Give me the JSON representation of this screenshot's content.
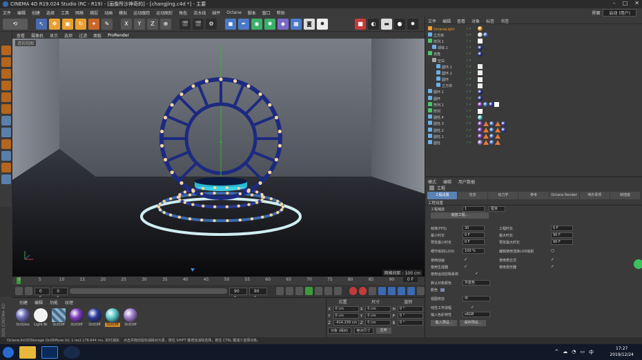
{
  "window": {
    "title": "CINEMA 4D R19.024 Studio (RC - R19) - [画像所沙神奇的] - [changjing.c4d *] - 主要",
    "controls": [
      "–",
      "□",
      "✕"
    ]
  },
  "menu": {
    "items": [
      "文件",
      "编辑",
      "创建",
      "选择",
      "工具",
      "网格",
      "捕捉",
      "动画",
      "模拟",
      "运动跟踪",
      "运动图形",
      "角色",
      "流水线",
      "插件",
      "Octane",
      "脚本",
      "窗口",
      "帮助"
    ],
    "layout_label": "界面",
    "layout_value": "启动 (用户)"
  },
  "toolbar": {
    "xyz": [
      "X",
      "Y",
      "Z"
    ]
  },
  "viewport": {
    "menu": [
      "查看",
      "摄像机",
      "显示",
      "选项",
      "过滤",
      "面板",
      "ProRender"
    ],
    "label": "透视视图",
    "grid_distance": "网格间距 : 100 cm"
  },
  "timeline": {
    "ticks": [
      "0",
      "5",
      "10",
      "15",
      "20",
      "25",
      "30",
      "35",
      "40",
      "45",
      "50",
      "55",
      "60",
      "65",
      "70",
      "75",
      "80",
      "85",
      "90"
    ],
    "current_frame": "0 F"
  },
  "playback": {
    "start": "0 F",
    "min": "0 F",
    "max": "90 F",
    "end": "90 F"
  },
  "materials": {
    "tabs": [
      "创建",
      "编辑",
      "功能",
      "纹理"
    ],
    "items": [
      {
        "label": "OctGlos",
        "color": "#6a6ab8"
      },
      {
        "label": "Light Br",
        "color": "#f2f2f2"
      },
      {
        "label": "OctDiff",
        "color": "#8ab0c8"
      },
      {
        "label": "OctDiff",
        "color": "#7a3ab8"
      },
      {
        "label": "OctDiff",
        "color": "#2a3a9a"
      },
      {
        "label": "OctDiff",
        "color": "#5ac8c8"
      },
      {
        "label": "OctDiff",
        "color": "#9a7ac8"
      }
    ],
    "selected_index": 5
  },
  "coordinates": {
    "headers": [
      "位置",
      "尺寸",
      "旋转"
    ],
    "rows": [
      {
        "axis": "X",
        "pos": "0 cm",
        "size": "0 cm",
        "rot_label": "H",
        "rot": "0 °"
      },
      {
        "axis": "Y",
        "pos": "0 cm",
        "size": "0 cm",
        "rot_label": "P",
        "rot": "0 °"
      },
      {
        "axis": "Z",
        "pos": "-414.239 cm",
        "size": "0 cm",
        "rot_label": "B",
        "rot": "0 °"
      }
    ],
    "mode": "对象 (相对)",
    "size_mode": "绝对尺寸",
    "apply": "应用"
  },
  "object_manager": {
    "menu": [
      "文件",
      "编辑",
      "查看",
      "对象",
      "标签",
      "书签"
    ],
    "objects": [
      {
        "name": "OctaneLight",
        "color": "#f0a030",
        "indent": 0,
        "selected": true
      },
      {
        "name": "立方体",
        "color": "#6ab0e8",
        "indent": 0
      },
      {
        "name": "阵列.1",
        "color": "#4ac86a",
        "indent": 0
      },
      {
        "name": "球体.1",
        "color": "#6ab0e8",
        "indent": 1
      },
      {
        "name": "克隆",
        "color": "#4ac86a",
        "indent": 0
      },
      {
        "name": "空白",
        "color": "#aaaaaa",
        "indent": 1
      },
      {
        "name": "圆环.1",
        "color": "#6ab0e8",
        "indent": 2
      },
      {
        "name": "圆环.2",
        "color": "#6ab0e8",
        "indent": 2
      },
      {
        "name": "圆环",
        "color": "#6ab0e8",
        "indent": 2
      },
      {
        "name": "立方体",
        "color": "#6ab0e8",
        "indent": 2
      },
      {
        "name": "圆环.1",
        "color": "#6ab0e8",
        "indent": 0
      },
      {
        "name": "圆环",
        "color": "#6ab0e8",
        "indent": 0
      },
      {
        "name": "阵列.1",
        "color": "#4ac86a",
        "indent": 0
      },
      {
        "name": "阵列",
        "color": "#4ac86a",
        "indent": 0
      },
      {
        "name": "圆柱.4",
        "color": "#6ab0e8",
        "indent": 0
      },
      {
        "name": "圆柱.3",
        "color": "#6ab0e8",
        "indent": 0
      },
      {
        "name": "圆柱.2",
        "color": "#6ab0e8",
        "indent": 0
      },
      {
        "name": "圆柱.1",
        "color": "#6ab0e8",
        "indent": 0
      },
      {
        "name": "圆柱",
        "color": "#6ab0e8",
        "indent": 0
      }
    ]
  },
  "attributes": {
    "menu": [
      "模式",
      "编辑",
      "用户数据"
    ],
    "title": "工程",
    "tabs": [
      "工程设置",
      "信息",
      "动力学",
      "参考",
      "Octane Render",
      "待办事项",
      "帧插值"
    ],
    "active_tab": 0,
    "section": "工程设置",
    "scale_label": "工程缩放",
    "scale_value": "1",
    "scale_unit": "厘米",
    "scale_button": "缩放工程...",
    "fps_label": "帧率(FPS)",
    "fps_value": "30",
    "time_label": "工程时长",
    "time_value": "0 F",
    "min_time_label": "最小时长",
    "min_time_value": "0 F",
    "max_time_label": "最大时长",
    "max_time_value": "90 F",
    "preview_min_label": "预览最小时长",
    "preview_min_value": "0 F",
    "preview_max_label": "预览最大时长",
    "preview_max_value": "90 F",
    "lod_label": "细节级别(LOD)",
    "lod_value": "100 %",
    "render_lod_label": "编辑使用渲染LOD级别",
    "use_anim_label": "使用动画",
    "use_expr_label": "使用表达式",
    "use_gen_label": "使用生成器",
    "use_deform_label": "使用变形器",
    "use_motion_label": "使用运动剪辑系统",
    "obj_color_label": "默认对象颜色",
    "obj_color_value": "灰蓝色",
    "color_label": "颜色",
    "view_clip_label": "视图修剪",
    "view_clip_value": "中",
    "linear_label": "线性工作流程",
    "input_color_label": "输入色彩特性",
    "input_color_value": "sRGB",
    "load_btn": "载入预设...",
    "save_btn": "保存预设..."
  },
  "status": {
    "text": "Octane:Init3DStorage OctDiffuse:3d, 1 rect   178.644 ms.    实时消除：  点击并拖动鼠标消除对元素，按住 SHIFT 键增加消除选择，按住 CTRL 键减少选择对象。"
  },
  "taskbar": {
    "time": "17:27",
    "date": "2019/12/24",
    "tray": [
      "^",
      "☁",
      "◔",
      "▭",
      "中"
    ]
  }
}
